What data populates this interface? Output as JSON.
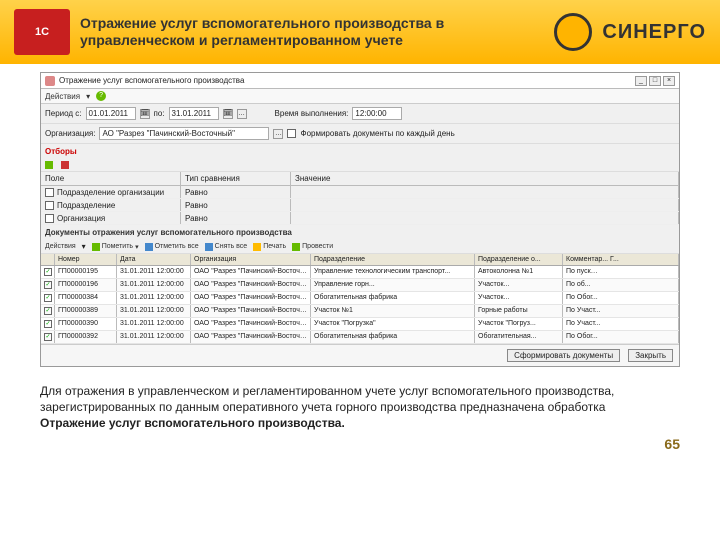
{
  "header": {
    "logo1c": "1C",
    "title": "Отражение услуг вспомогательного производства в управленческом и регламентированном учете",
    "brand": "СИНЕРГО"
  },
  "window": {
    "title": "Отражение услуг вспомогательного производства",
    "actions_label": "Действия",
    "period": {
      "label": "Период с:",
      "from": "01.01.2011",
      "to_label": "по:",
      "to": "31.01.2011",
      "time_label": "Время выполнения:",
      "time": "12:00:00"
    },
    "org": {
      "label": "Организация:",
      "value": "АО \"Разрез \"Пачинский-Восточный\"",
      "chk_label": "Формировать документы по каждый день"
    },
    "filters": {
      "title": "Отборы",
      "cols": [
        "Поле",
        "Тип сравнения",
        "Значение"
      ],
      "rows": [
        {
          "f": "Подразделение организации",
          "t": "Равно",
          "v": ""
        },
        {
          "f": "Подразделение",
          "t": "Равно",
          "v": ""
        },
        {
          "f": "Организация",
          "t": "Равно",
          "v": ""
        }
      ]
    },
    "docs": {
      "title": "Документы отражения услуг вспомогательного производства",
      "tb": [
        "Действия",
        "Пометить",
        "Отметить все",
        "Снять все",
        "Печать",
        "Провести"
      ],
      "cols": [
        "",
        "Номер",
        "Дата",
        "Организация",
        "Подразделение",
        "Подразделение о...",
        "Комментар... Г..."
      ],
      "rows": [
        {
          "n": "ГП00000195",
          "d": "31.01.2011 12:00:00",
          "o": "ОАО \"Разрез \"Пачинский-Восточный\"",
          "p": "Управление технологическим транспорт...",
          "p2": "Автоколонна №1",
          "c": "По пуск…"
        },
        {
          "n": "ГП00000196",
          "d": "31.01.2011 12:00:00",
          "o": "ОАО \"Разрез \"Пачинский-Восточный\"",
          "p": "Управление горн...",
          "p2": "Участок...",
          "c": "По об..."
        },
        {
          "n": "ГП00000384",
          "d": "31.01.2011 12:00:00",
          "o": "ОАО \"Разрез \"Пачинский-Восточный\"",
          "p": "Обогатительная фабрика",
          "p2": "Участок...",
          "c": "По Обог..."
        },
        {
          "n": "ГП00000389",
          "d": "31.01.2011 12:00:00",
          "o": "ОАО \"Разрез \"Пачинский-Восточный\"",
          "p": "Участок №1",
          "p2": "Горные работы",
          "c": "По Участ..."
        },
        {
          "n": "ГП00000390",
          "d": "31.01.2011 12:00:00",
          "o": "ОАО \"Разрез \"Пачинский-Восточный\"",
          "p": "Участок \"Погрузка\"",
          "p2": "Участок \"Погруз...",
          "c": "По Участ..."
        },
        {
          "n": "ГП00000392",
          "d": "31.01.2011 12:00:00",
          "o": "ОАО \"Разрез \"Пачинский-Восточный\"",
          "p": "Обогатительная фабрика",
          "p2": "Обогатительная...",
          "c": "По Обог..."
        }
      ]
    },
    "footer": {
      "gen": "Сформировать документы",
      "close": "Закрыть"
    }
  },
  "caption": {
    "p1": "Для отражения в управленческом и регламентированном учете услуг вспомогательного производства, зарегистрированных по данным оперативного учета горного производства предназначена  обработка",
    "p2": "Отражение услуг вспомогательного производства."
  },
  "page": "65"
}
